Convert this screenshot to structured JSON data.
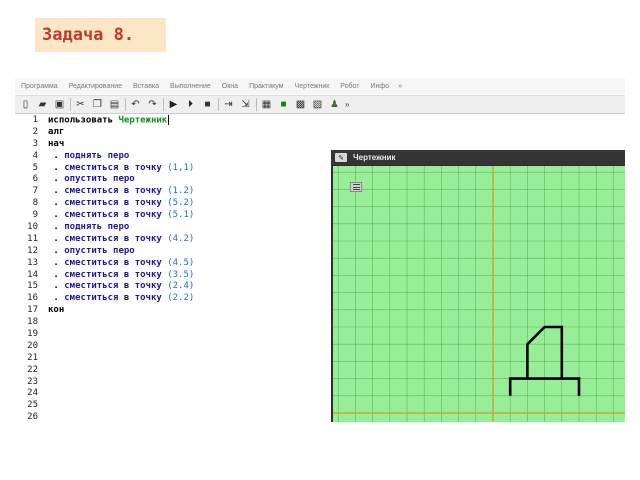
{
  "task_title": "Задача 8.",
  "menu": [
    "Программа",
    "Редактирование",
    "Вставка",
    "Выполнение",
    "Окна",
    "Практикум",
    "Чертежник",
    "Робот",
    "Инфо"
  ],
  "menu_more": "»",
  "toolbar": {
    "icons": [
      "new-file-icon",
      "open-folder-icon",
      "save-icon",
      "cut-icon",
      "copy-icon",
      "paste-icon",
      "undo-icon",
      "redo-icon",
      "run-icon",
      "run-step-icon",
      "stop-icon",
      "step-over-icon",
      "step-into-icon",
      "panel-icon",
      "green-square-icon",
      "grid-icon",
      "grid-tools-icon",
      "robot-icon"
    ],
    "more": "»"
  },
  "editor": {
    "line_numbers": [
      "1",
      "2",
      "3",
      "4",
      "5",
      "6",
      "7",
      "8",
      "9",
      "10",
      "11",
      "12",
      "13",
      "14",
      "15",
      "16",
      "17",
      "18",
      "19",
      "20",
      "21",
      "22",
      "23",
      "24",
      "25",
      "26"
    ],
    "lines": [
      [
        {
          "t": "использовать ",
          "c": "kw"
        },
        {
          "t": "Чертежник",
          "c": "mod"
        }
      ],
      [
        {
          "t": "алг",
          "c": "kw"
        }
      ],
      [
        {
          "t": "нач",
          "c": "kw"
        }
      ],
      [
        {
          "t": " . ",
          "c": "dot"
        },
        {
          "t": "поднять перо",
          "c": "cmd"
        }
      ],
      [
        {
          "t": " . ",
          "c": "dot"
        },
        {
          "t": "сместиться в точку ",
          "c": "cmd"
        },
        {
          "t": "(1,1)",
          "c": "arg"
        }
      ],
      [
        {
          "t": " . ",
          "c": "dot"
        },
        {
          "t": "опустить перо",
          "c": "cmd"
        }
      ],
      [
        {
          "t": " . ",
          "c": "dot"
        },
        {
          "t": "сместиться в точку ",
          "c": "cmd"
        },
        {
          "t": "(1.2)",
          "c": "arg"
        }
      ],
      [
        {
          "t": " . ",
          "c": "dot"
        },
        {
          "t": "сместиться в точку ",
          "c": "cmd"
        },
        {
          "t": "(5.2)",
          "c": "arg"
        }
      ],
      [
        {
          "t": " . ",
          "c": "dot"
        },
        {
          "t": "сместиться в точку ",
          "c": "cmd"
        },
        {
          "t": "(5.1)",
          "c": "arg"
        }
      ],
      [
        {
          "t": " . ",
          "c": "dot"
        },
        {
          "t": "поднять перо",
          "c": "cmd"
        }
      ],
      [
        {
          "t": " . ",
          "c": "dot"
        },
        {
          "t": "сместиться в точку ",
          "c": "cmd"
        },
        {
          "t": "(4.2)",
          "c": "arg"
        }
      ],
      [
        {
          "t": " . ",
          "c": "dot"
        },
        {
          "t": "опустить перо",
          "c": "cmd"
        }
      ],
      [
        {
          "t": " . ",
          "c": "dot"
        },
        {
          "t": "сместиться в точку ",
          "c": "cmd"
        },
        {
          "t": "(4.5)",
          "c": "arg"
        }
      ],
      [
        {
          "t": " . ",
          "c": "dot"
        },
        {
          "t": "сместиться в точку ",
          "c": "cmd"
        },
        {
          "t": "(3.5)",
          "c": "arg"
        }
      ],
      [
        {
          "t": " . ",
          "c": "dot"
        },
        {
          "t": "сместиться в точку ",
          "c": "cmd"
        },
        {
          "t": "(2.4)",
          "c": "arg"
        }
      ],
      [
        {
          "t": " . ",
          "c": "dot"
        },
        {
          "t": "сместиться в точку ",
          "c": "cmd"
        },
        {
          "t": "(2.2)",
          "c": "arg"
        }
      ],
      [
        {
          "t": "кон",
          "c": "kw"
        }
      ],
      [],
      [],
      [],
      [],
      [],
      [],
      [],
      [],
      []
    ]
  },
  "drawer": {
    "title": "Чертежник",
    "canvas_color": "#98ee98",
    "grid_color": "#2e8b2e",
    "axis_color": "#c8a12a",
    "drawing_segments": [
      [
        [
          1,
          1
        ],
        [
          1,
          2
        ],
        [
          5,
          2
        ],
        [
          5,
          1
        ]
      ],
      [
        [
          4,
          2
        ],
        [
          4,
          5
        ],
        [
          3,
          5
        ],
        [
          2,
          4
        ],
        [
          2,
          2
        ]
      ]
    ]
  }
}
